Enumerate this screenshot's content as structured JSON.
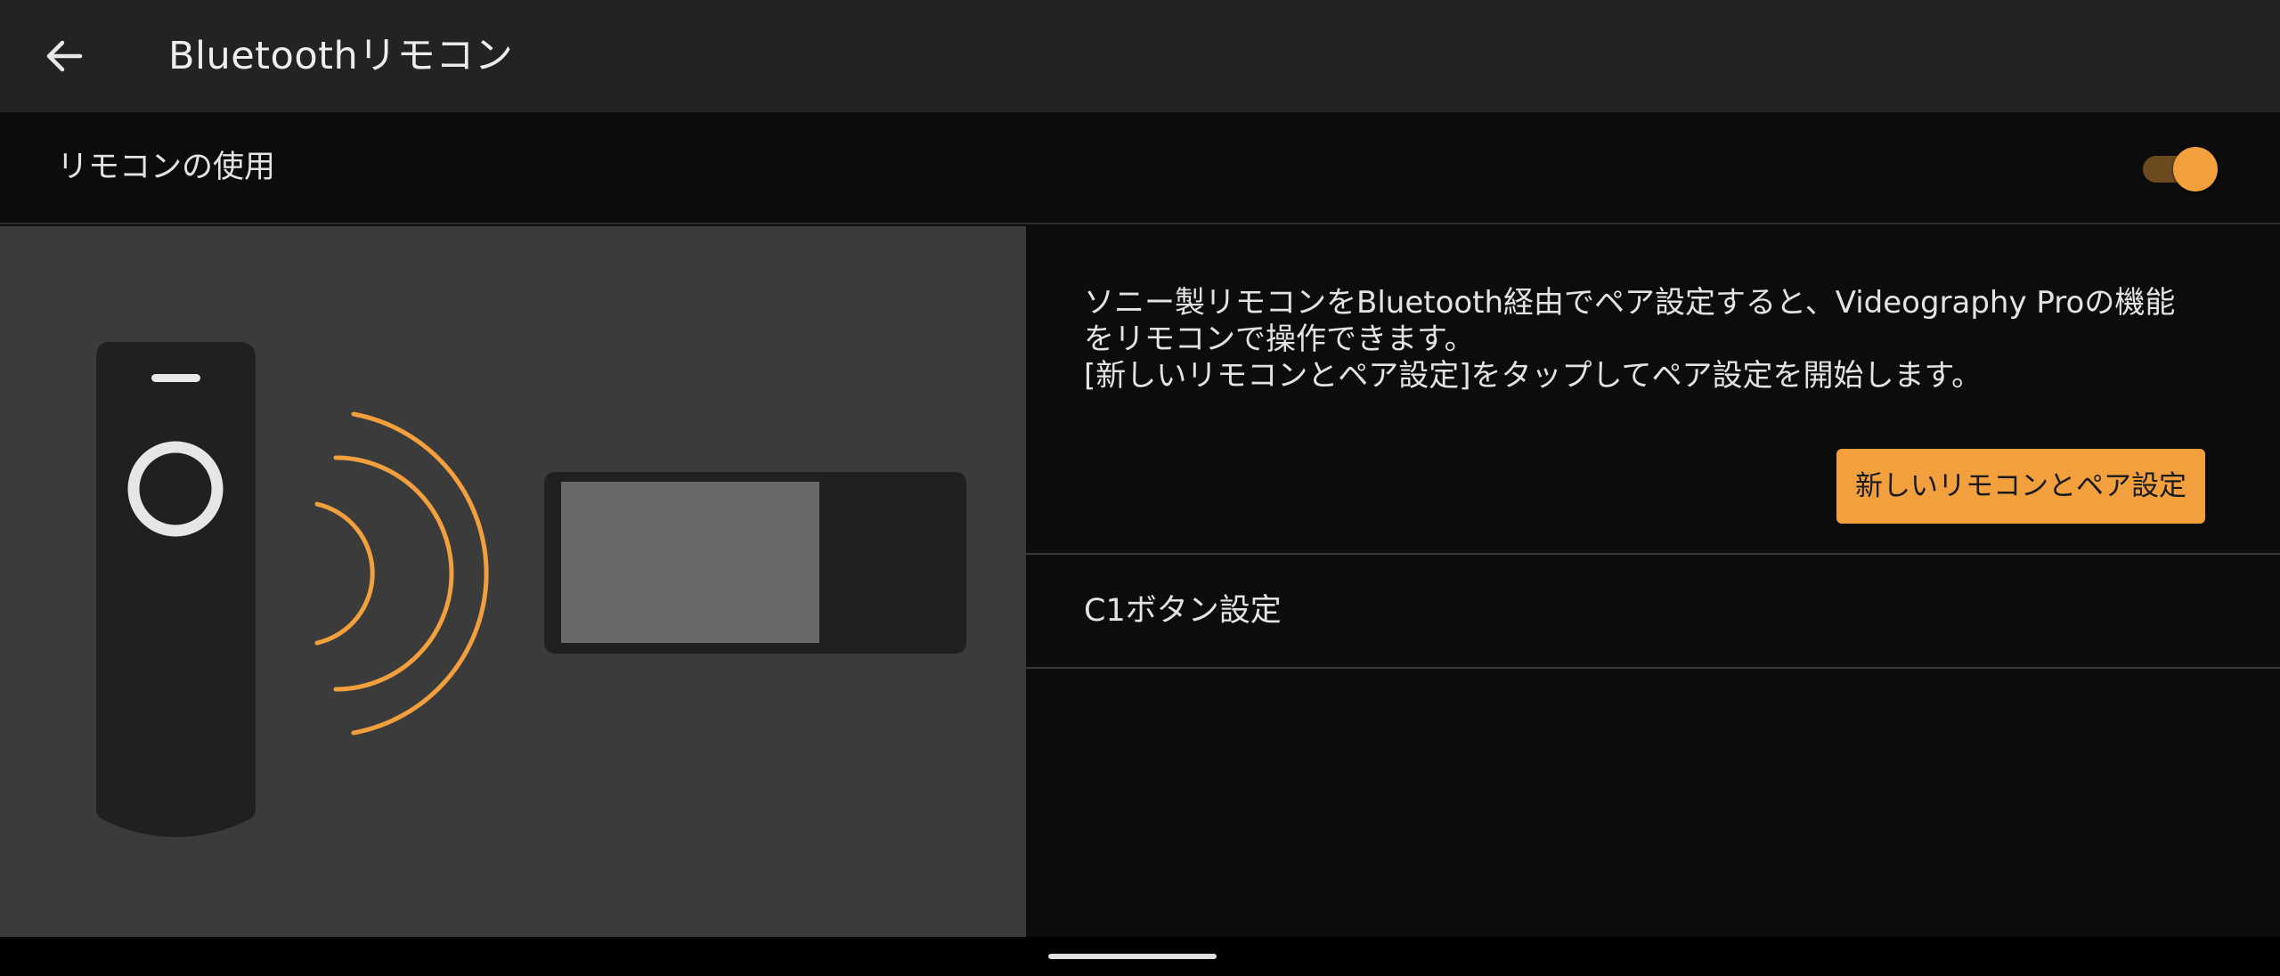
{
  "appbar": {
    "title": "Bluetoothリモコン",
    "back_icon": "arrow-left-icon"
  },
  "remote_toggle": {
    "label": "リモコンの使用",
    "enabled": true,
    "accent_color": "#f2a03d"
  },
  "illustration": {
    "description_icons": [
      "remote-control-icon",
      "signal-waves-icon",
      "phone-icon"
    ]
  },
  "info": {
    "lines": [
      "ソニー製リモコンをBluetooth経由でペア設定すると、Videography Proの機能",
      "をリモコンで操作できます。",
      "[新しいリモコンとペア設定]をタップしてペア設定を開始します。"
    ],
    "pair_button_label": "新しいリモコンとペア設定"
  },
  "c1_button": {
    "label": "C1ボタン設定"
  },
  "colors": {
    "accent": "#f2a03d",
    "appbar_bg": "#232323",
    "panel_bg": "#0c0c0c",
    "illustration_bg": "#3b3b3b"
  }
}
